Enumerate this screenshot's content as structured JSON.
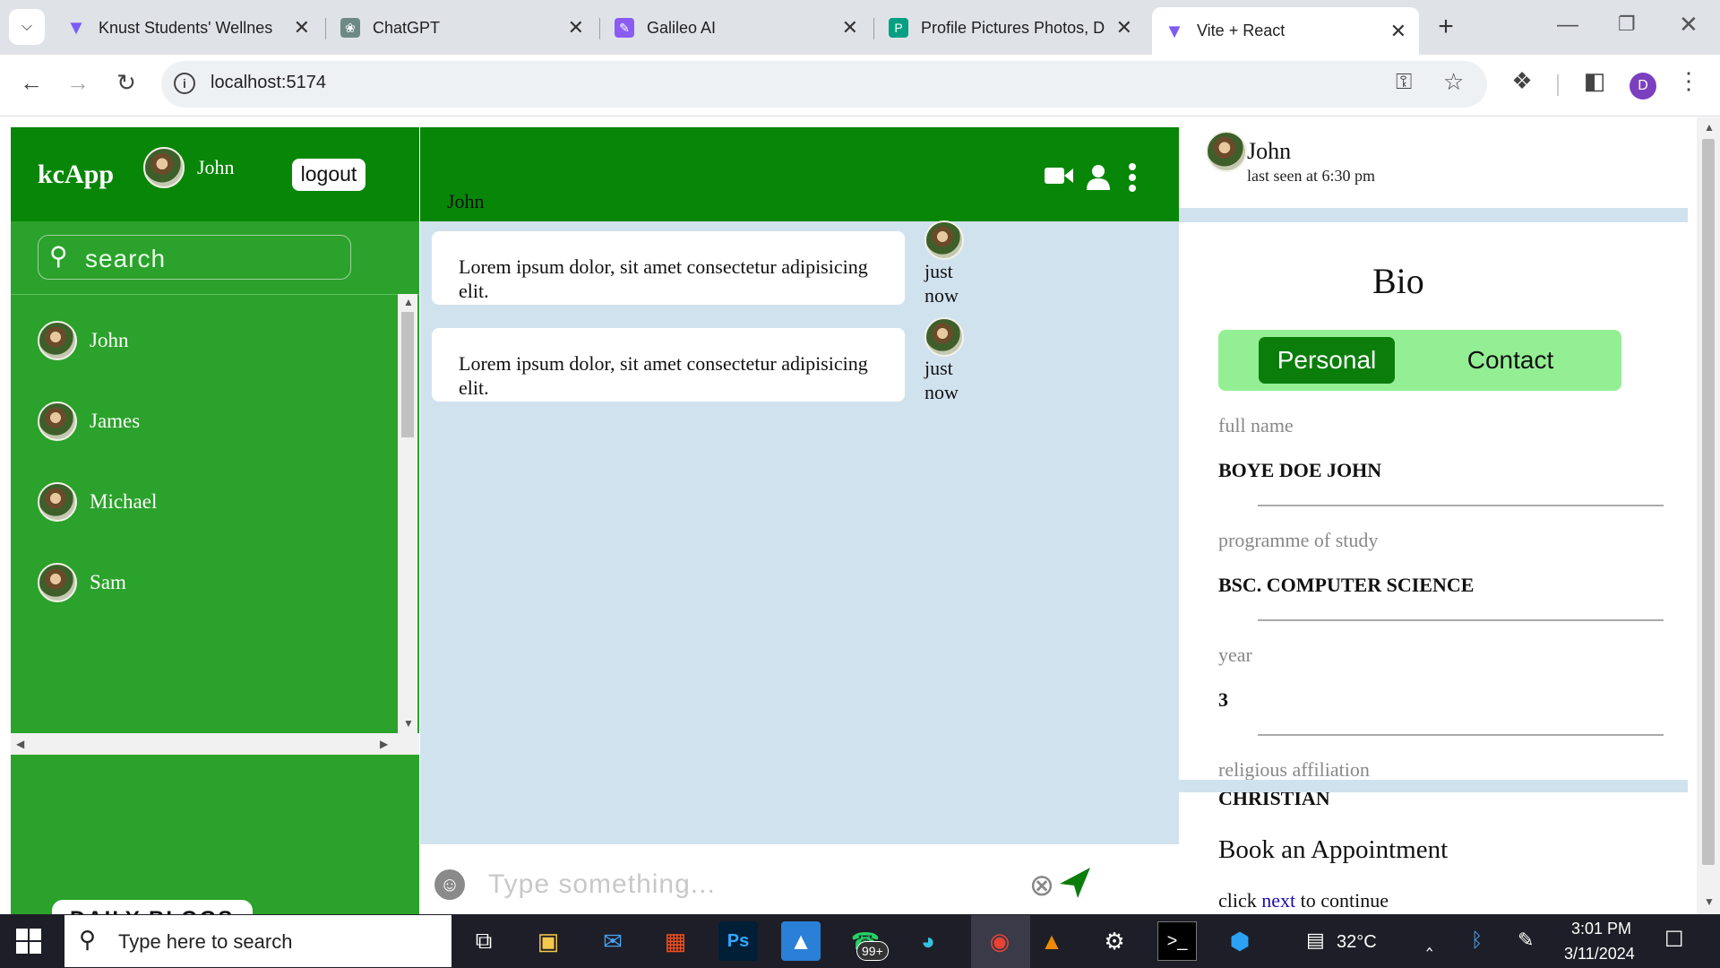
{
  "browser": {
    "tabs": [
      {
        "title": "Knust Students' Wellnes",
        "icon": "vite-icon",
        "color": "#7b5cf5"
      },
      {
        "title": "ChatGPT",
        "icon": "chatgpt-icon",
        "color": "#10a37f"
      },
      {
        "title": "Galileo AI",
        "icon": "galileo-icon",
        "color": "#8a5cf5"
      },
      {
        "title": "Profile Pictures Photos, D",
        "icon": "pexels-icon",
        "color": "#05a081"
      },
      {
        "title": "Vite + React",
        "icon": "vite-icon",
        "color": "#7b5cf5"
      }
    ],
    "url": "localhost:5174",
    "profile_initial": "D"
  },
  "app": {
    "brand": "kcApp",
    "current_user": "John",
    "logout_label": "logout",
    "search_placeholder": "search",
    "contacts": [
      "John",
      "James",
      "Michael",
      "Sam"
    ],
    "daily_blogs_label": "DAILY BLOGS",
    "chat": {
      "contact_name": "John",
      "messages": [
        {
          "text": "Lorem ipsum dolor, sit amet consectetur adipisicing elit.",
          "time_line1": "just",
          "time_line2": "now"
        },
        {
          "text": "Lorem ipsum dolor, sit amet consectetur adipisicing elit.",
          "time_line1": "just",
          "time_line2": "now"
        }
      ],
      "input_placeholder": "Type something..."
    },
    "profile": {
      "name": "John",
      "last_seen": "last seen at 6:30 pm",
      "bio_title": "Bio",
      "tabs": {
        "personal": "Personal",
        "contact": "Contact"
      },
      "fields": [
        {
          "label": "full name",
          "value": "BOYE DOE JOHN"
        },
        {
          "label": "programme of study",
          "value": "BSC. COMPUTER SCIENCE"
        },
        {
          "label": "year",
          "value": "3"
        },
        {
          "label": "religious affiliation",
          "value": "CHRISTIAN"
        }
      ],
      "appointment_title": "Book an Appointment",
      "appointment_pre": "click",
      "appointment_link": "next",
      "appointment_post": "to continue"
    }
  },
  "taskbar": {
    "search_placeholder": "Type here to search",
    "whatsapp_badge": "99+",
    "weather": "32°C",
    "time": "3:01 PM",
    "date": "3/11/2024"
  },
  "colors": {
    "header_green": "#088608",
    "sidebar_green": "#2ba22b",
    "chat_bg": "#d1e2ef",
    "tab_active_green": "#0b7d0b",
    "tab_bg_green": "#94ef94"
  }
}
